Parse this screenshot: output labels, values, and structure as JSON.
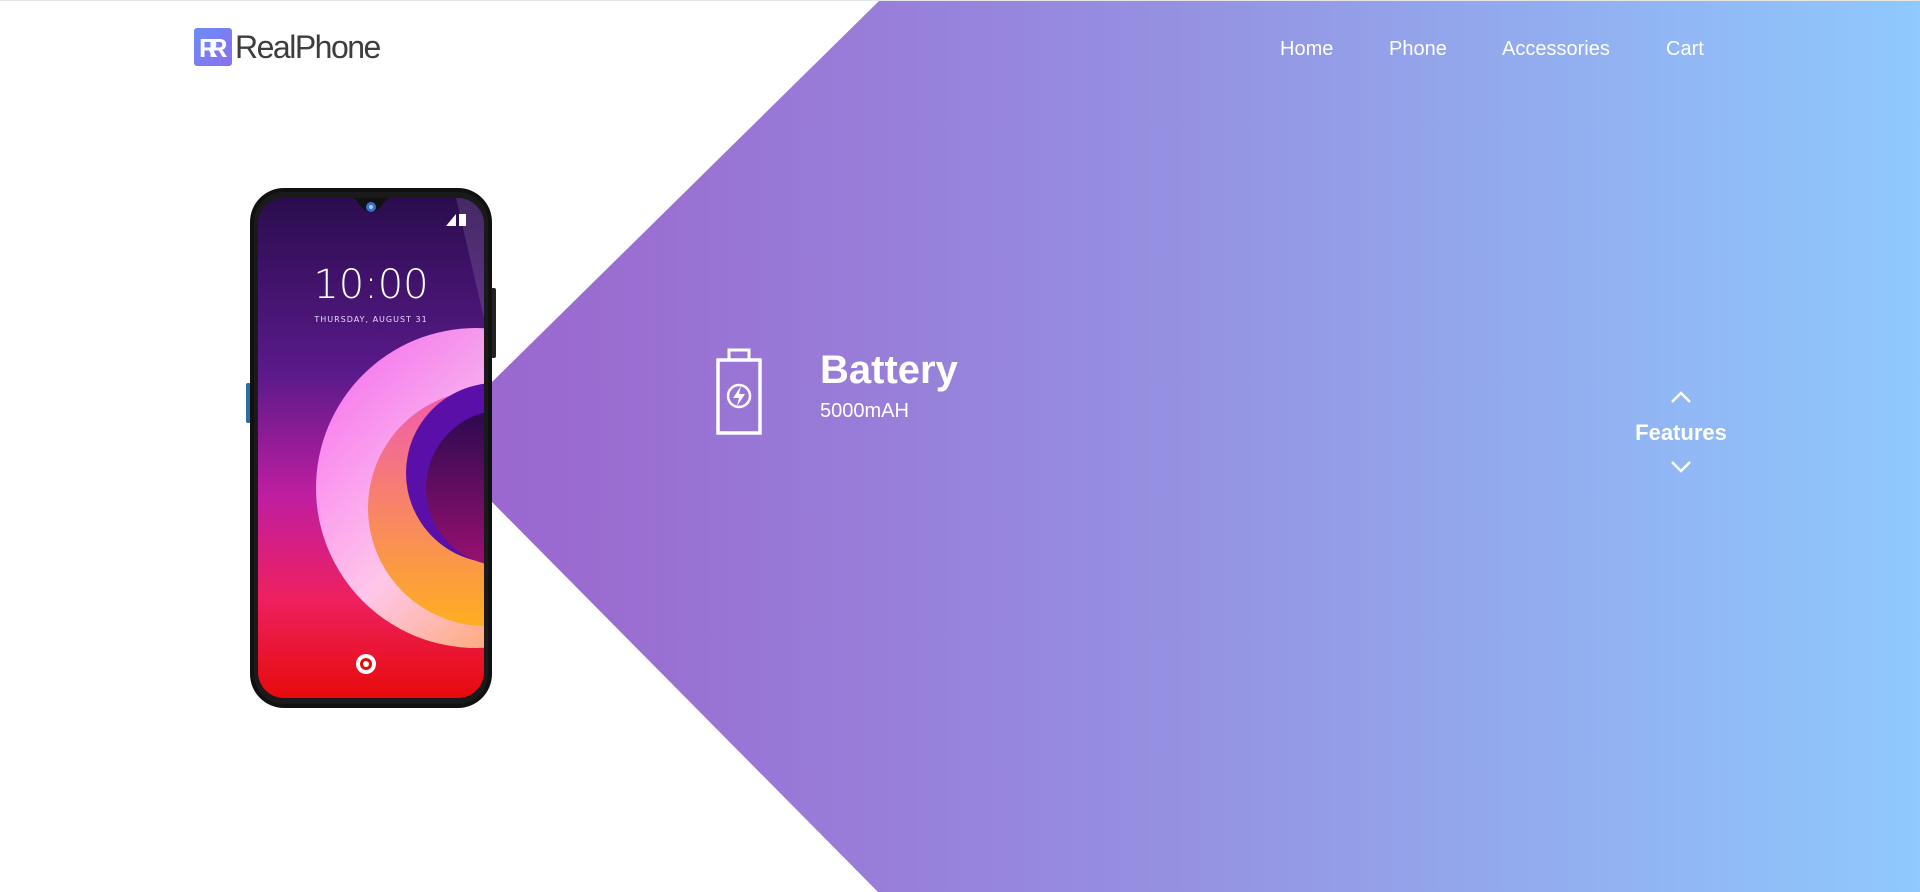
{
  "brand": {
    "logo_letters": "RR",
    "name": "RealPhone"
  },
  "nav": {
    "items": [
      {
        "label": "Home"
      },
      {
        "label": "Phone"
      },
      {
        "label": "Accessories"
      },
      {
        "label": "Cart"
      }
    ]
  },
  "phone_screen": {
    "time": "10:00",
    "date": "THURSDAY, AUGUST 31"
  },
  "feature": {
    "icon": "battery-charging-icon",
    "title": "Battery",
    "value": "5000mAH"
  },
  "switcher": {
    "label": "Features",
    "up_icon": "chevron-up-icon",
    "down_icon": "chevron-down-icon"
  },
  "colors": {
    "gradient_start": "#9656c8",
    "gradient_end": "#8fc9fd",
    "brand_text": "#3d3d3d",
    "logo_accent": "#7a7ef2"
  }
}
